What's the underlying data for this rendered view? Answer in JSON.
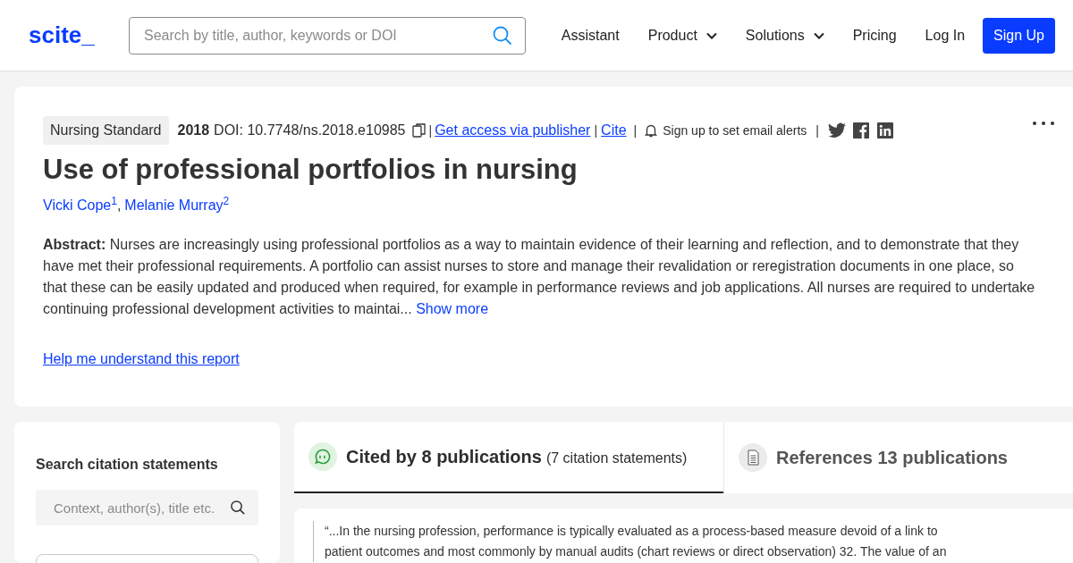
{
  "header": {
    "logo": "scite_",
    "search": {
      "placeholder": "Search by title, author, keywords or DOI"
    },
    "nav": [
      {
        "label": "Assistant",
        "dropdown": false
      },
      {
        "label": "Product",
        "dropdown": true
      },
      {
        "label": "Solutions",
        "dropdown": true
      },
      {
        "label": "Pricing",
        "dropdown": false
      },
      {
        "label": "Log In",
        "dropdown": false
      }
    ],
    "signup": "Sign Up"
  },
  "article": {
    "journal": "Nursing Standard",
    "year": "2018",
    "doi": "DOI: 10.7748/ns.2018.e10985",
    "access_link": "Get access via publisher",
    "cite_link": "Cite",
    "alerts": "Sign up to set email alerts",
    "separators": [
      "|",
      "|",
      "|",
      "|"
    ],
    "author_separator": ",",
    "title": "Use of professional portfolios in nursing",
    "authors": [
      "Vicki Cope$^{1}$",
      "Melanie Murray$^{2}$"
    ],
    "abstract": "**Abstract:** Nurses are increasingly using professional portfolios as a way to maintain evidence of their learning and reflection, and to demonstrate that they have met their professional requirements. A portfolio can assist nurses to store and manage their revalidation or reregistration documents in one place, so that these can be easily updated and produced when required, for example in performance reviews and job applications. All nurses are required to undertake continuing professional development activities to maintai...",
    "show_more": "Show more",
    "help_link": "Help me understand this report"
  },
  "sidebar": {
    "heading": "Search citation statements",
    "search": {
      "placeholder": "Context, author(s), title etc."
    }
  },
  "tabs": [
    {
      "kind": "cited",
      "label": "Cited by 8 publications",
      "detail": "(7 citation statements)",
      "selected": true
    },
    {
      "kind": "references",
      "label": "References 13 publications",
      "selected": false
    }
  ],
  "citation": {
    "quote": "“...In the nursing profession, performance is typically evaluated as a process-based measure devoid of a link to\npatient outcomes and most commonly by manual audits (chart reviews or direct observation) 32. The value of an"
  }
}
